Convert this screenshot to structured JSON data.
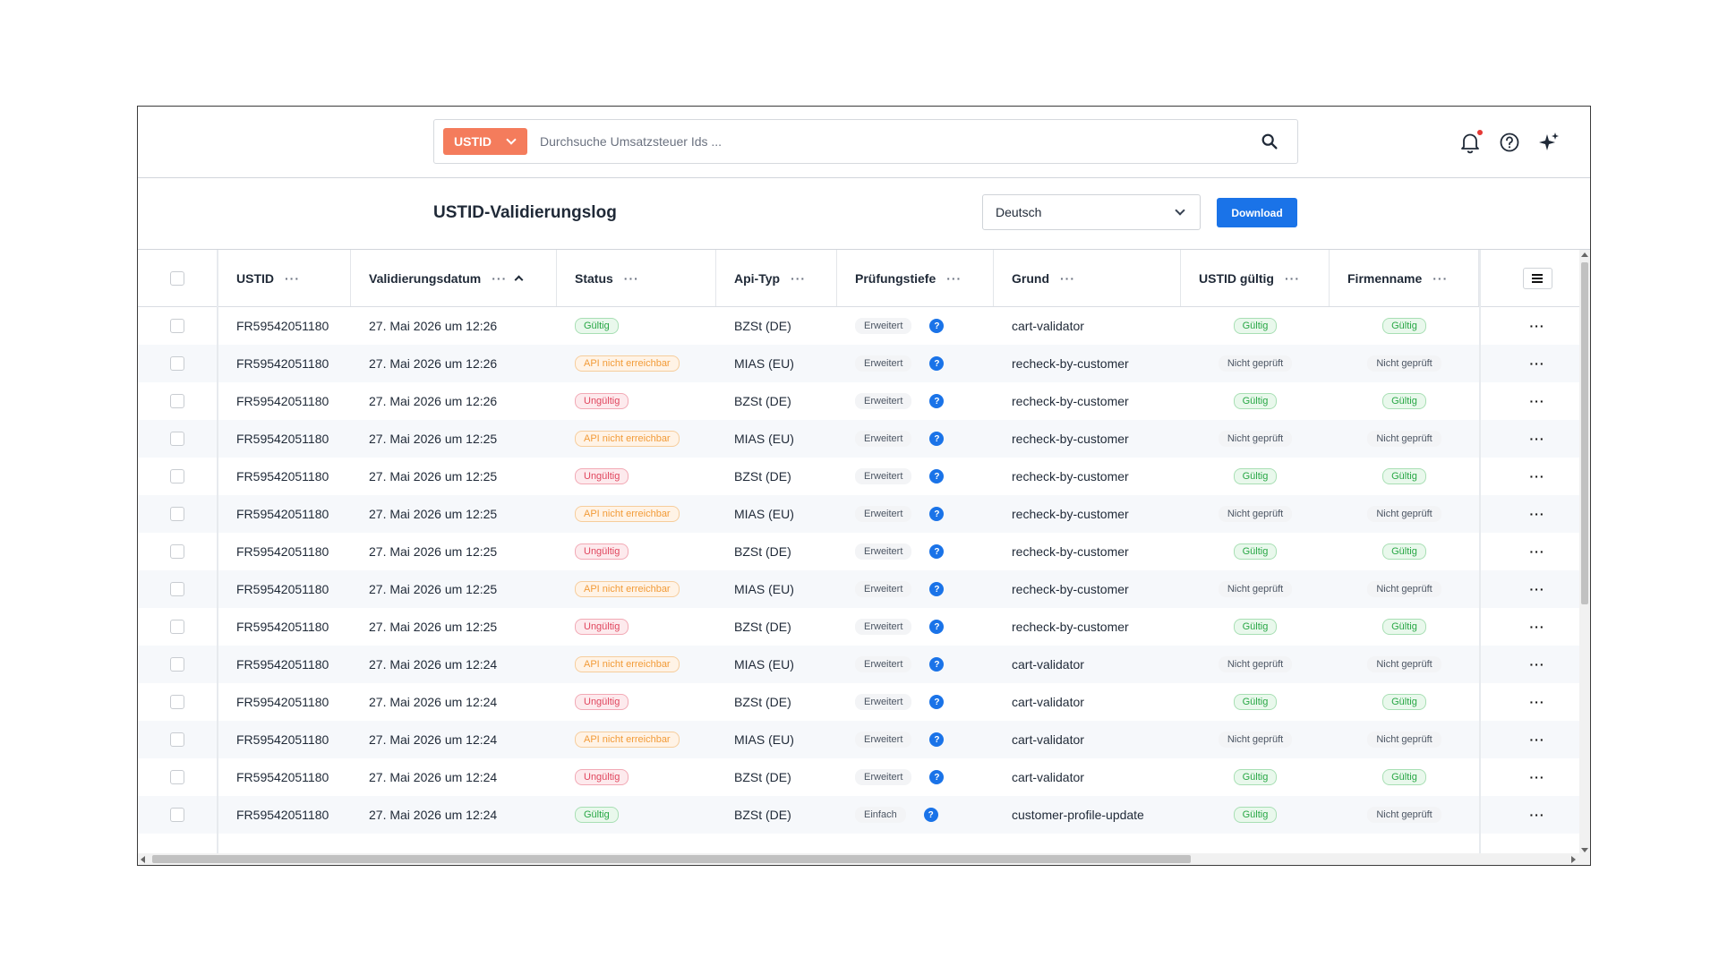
{
  "search": {
    "type_label": "USTID",
    "placeholder": "Durchsuche Umsatzsteuer Ids ...",
    "value": ""
  },
  "page": {
    "title": "USTID-Validierungslog",
    "language": "Deutsch",
    "download_label": "Download"
  },
  "icons": [
    "chevron-down-icon",
    "search-icon",
    "bell-icon",
    "help-icon",
    "sparkle-icon",
    "menu-icon",
    "more-icon",
    "question-icon"
  ],
  "colors": {
    "accent": "#1a73e8",
    "type_select": "#f47c5c",
    "valid": "#28a745",
    "warning": "#f29b38",
    "invalid": "#e0465e"
  },
  "table": {
    "columns": [
      {
        "label": "USTID",
        "dots": "···"
      },
      {
        "label": "Validierungsdatum",
        "dots": "···"
      },
      {
        "label": "Status",
        "dots": "···"
      },
      {
        "label": "Api-Typ",
        "dots": "···"
      },
      {
        "label": "Prüfungstiefe",
        "dots": "···"
      },
      {
        "label": "Grund",
        "dots": "···"
      },
      {
        "label": "USTID gültig",
        "dots": "···"
      },
      {
        "label": "Firmenname",
        "dots": "···"
      }
    ],
    "row_action": "···",
    "help_mark": "?",
    "rows": [
      {
        "ustid": "FR59542051180",
        "date": "27. Mai 2026 um 12:26",
        "status": "Gültig",
        "status_kind": "green",
        "api": "BZSt (DE)",
        "depth": "Erweitert",
        "reason": "cart-validator",
        "valid": "Gültig",
        "valid_kind": "green",
        "company": "Gültig",
        "company_kind": "green"
      },
      {
        "ustid": "FR59542051180",
        "date": "27. Mai 2026 um 12:26",
        "status": "API nicht erreichbar",
        "status_kind": "orange",
        "api": "MIAS (EU)",
        "depth": "Erweitert",
        "reason": "recheck-by-customer",
        "valid": "Nicht geprüft",
        "valid_kind": "gray",
        "company": "Nicht geprüft",
        "company_kind": "gray"
      },
      {
        "ustid": "FR59542051180",
        "date": "27. Mai 2026 um 12:26",
        "status": "Ungültig",
        "status_kind": "red",
        "api": "BZSt (DE)",
        "depth": "Erweitert",
        "reason": "recheck-by-customer",
        "valid": "Gültig",
        "valid_kind": "green",
        "company": "Gültig",
        "company_kind": "green"
      },
      {
        "ustid": "FR59542051180",
        "date": "27. Mai 2026 um 12:25",
        "status": "API nicht erreichbar",
        "status_kind": "orange",
        "api": "MIAS (EU)",
        "depth": "Erweitert",
        "reason": "recheck-by-customer",
        "valid": "Nicht geprüft",
        "valid_kind": "gray",
        "company": "Nicht geprüft",
        "company_kind": "gray"
      },
      {
        "ustid": "FR59542051180",
        "date": "27. Mai 2026 um 12:25",
        "status": "Ungültig",
        "status_kind": "red",
        "api": "BZSt (DE)",
        "depth": "Erweitert",
        "reason": "recheck-by-customer",
        "valid": "Gültig",
        "valid_kind": "green",
        "company": "Gültig",
        "company_kind": "green"
      },
      {
        "ustid": "FR59542051180",
        "date": "27. Mai 2026 um 12:25",
        "status": "API nicht erreichbar",
        "status_kind": "orange",
        "api": "MIAS (EU)",
        "depth": "Erweitert",
        "reason": "recheck-by-customer",
        "valid": "Nicht geprüft",
        "valid_kind": "gray",
        "company": "Nicht geprüft",
        "company_kind": "gray"
      },
      {
        "ustid": "FR59542051180",
        "date": "27. Mai 2026 um 12:25",
        "status": "Ungültig",
        "status_kind": "red",
        "api": "BZSt (DE)",
        "depth": "Erweitert",
        "reason": "recheck-by-customer",
        "valid": "Gültig",
        "valid_kind": "green",
        "company": "Gültig",
        "company_kind": "green"
      },
      {
        "ustid": "FR59542051180",
        "date": "27. Mai 2026 um 12:25",
        "status": "API nicht erreichbar",
        "status_kind": "orange",
        "api": "MIAS (EU)",
        "depth": "Erweitert",
        "reason": "recheck-by-customer",
        "valid": "Nicht geprüft",
        "valid_kind": "gray",
        "company": "Nicht geprüft",
        "company_kind": "gray"
      },
      {
        "ustid": "FR59542051180",
        "date": "27. Mai 2026 um 12:25",
        "status": "Ungültig",
        "status_kind": "red",
        "api": "BZSt (DE)",
        "depth": "Erweitert",
        "reason": "recheck-by-customer",
        "valid": "Gültig",
        "valid_kind": "green",
        "company": "Gültig",
        "company_kind": "green"
      },
      {
        "ustid": "FR59542051180",
        "date": "27. Mai 2026 um 12:24",
        "status": "API nicht erreichbar",
        "status_kind": "orange",
        "api": "MIAS (EU)",
        "depth": "Erweitert",
        "reason": "cart-validator",
        "valid": "Nicht geprüft",
        "valid_kind": "gray",
        "company": "Nicht geprüft",
        "company_kind": "gray"
      },
      {
        "ustid": "FR59542051180",
        "date": "27. Mai 2026 um 12:24",
        "status": "Ungültig",
        "status_kind": "red",
        "api": "BZSt (DE)",
        "depth": "Erweitert",
        "reason": "cart-validator",
        "valid": "Gültig",
        "valid_kind": "green",
        "company": "Gültig",
        "company_kind": "green"
      },
      {
        "ustid": "FR59542051180",
        "date": "27. Mai 2026 um 12:24",
        "status": "API nicht erreichbar",
        "status_kind": "orange",
        "api": "MIAS (EU)",
        "depth": "Erweitert",
        "reason": "cart-validator",
        "valid": "Nicht geprüft",
        "valid_kind": "gray",
        "company": "Nicht geprüft",
        "company_kind": "gray"
      },
      {
        "ustid": "FR59542051180",
        "date": "27. Mai 2026 um 12:24",
        "status": "Ungültig",
        "status_kind": "red",
        "api": "BZSt (DE)",
        "depth": "Erweitert",
        "reason": "cart-validator",
        "valid": "Gültig",
        "valid_kind": "green",
        "company": "Gültig",
        "company_kind": "green"
      },
      {
        "ustid": "FR59542051180",
        "date": "27. Mai 2026 um 12:24",
        "status": "Gültig",
        "status_kind": "green",
        "api": "BZSt (DE)",
        "depth": "Einfach",
        "reason": "customer-profile-update",
        "valid": "Gültig",
        "valid_kind": "green",
        "company": "Nicht geprüft",
        "company_kind": "gray"
      }
    ]
  }
}
